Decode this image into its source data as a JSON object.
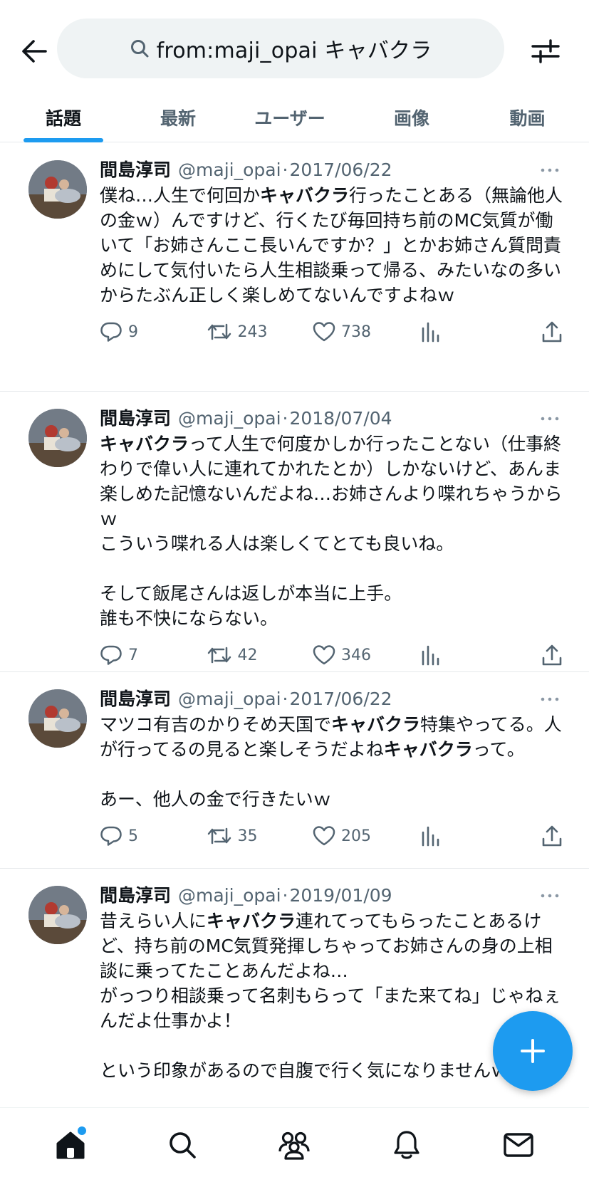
{
  "search": {
    "query": "from:maji_opai キャバクラ"
  },
  "tabs": [
    {
      "label": "話題",
      "active": true
    },
    {
      "label": "最新",
      "active": false
    },
    {
      "label": "ユーザー",
      "active": false
    },
    {
      "label": "画像",
      "active": false
    },
    {
      "label": "動画",
      "active": false
    }
  ],
  "posts": [
    {
      "name": "間島淳司",
      "handle": "@maji_opai",
      "date": "2017/06/22",
      "body_parts": [
        {
          "t": "僕ね…人生で何回か"
        },
        {
          "t": "キャバクラ",
          "b": true
        },
        {
          "t": "行ったことある（無論他人の金ｗ）んですけど、行くたび毎回持ち前のMC気質が働いて「お姉さんここ長いんですか？」とかお姉さん質問責めにして気付いたら人生相談乗って帰る、みたいなの多いからたぶん正しく楽しめてないんですよねｗ"
        }
      ],
      "replies": "9",
      "reposts": "243",
      "likes": "738"
    },
    {
      "name": "間島淳司",
      "handle": "@maji_opai",
      "date": "2018/07/04",
      "body_parts": [
        {
          "t": "キャバクラ",
          "b": true
        },
        {
          "t": "って人生で何度かしか行ったことない（仕事終わりで偉い人に連れてかれたとか）しかないけど、あんま楽しめた記憶ないんだよね…お姉さんより喋れちゃうからｗ\nこういう喋れる人は楽しくてとても良いね。\n\nそして飯尾さんは返しが本当に上手。\n誰も不快にならない。"
        }
      ],
      "replies": "7",
      "reposts": "42",
      "likes": "346"
    },
    {
      "name": "間島淳司",
      "handle": "@maji_opai",
      "date": "2017/06/22",
      "body_parts": [
        {
          "t": "マツコ有吉のかりそめ天国で"
        },
        {
          "t": "キャバクラ",
          "b": true
        },
        {
          "t": "特集やってる。人が行ってるの見ると楽しそうだよね"
        },
        {
          "t": "キャバクラ",
          "b": true
        },
        {
          "t": "って。\n\nあー、他人の金で行きたいｗ"
        }
      ],
      "replies": "5",
      "reposts": "35",
      "likes": "205"
    },
    {
      "name": "間島淳司",
      "handle": "@maji_opai",
      "date": "2019/01/09",
      "body_parts": [
        {
          "t": "昔えらい人に"
        },
        {
          "t": "キャバクラ",
          "b": true
        },
        {
          "t": "連れてってもらったことあるけど、持ち前のMC気質発揮しちゃってお姉さんの身の上相談に乗ってたことあんだよね…\nがっつり相談乗って名刺もらって「また来てね」じゃねぇんだよ仕事かよ！\n\nという印象があるので自腹で行く気になりませんｗ"
        }
      ],
      "replies": "",
      "reposts": "",
      "likes": ""
    }
  ],
  "icons": {
    "back": "arrow-left-icon",
    "search": "search-icon",
    "filter": "sliders-icon",
    "reply": "reply-icon",
    "repost": "repost-icon",
    "like": "heart-icon",
    "views": "analytics-icon",
    "share": "share-icon",
    "compose": "plus-icon",
    "home": "home-icon",
    "explore": "search-icon",
    "communities": "people-icon",
    "notifications": "bell-icon",
    "messages": "mail-icon"
  },
  "colors": {
    "accent": "#1d9bf0",
    "text": "#0f1419",
    "muted": "#536471"
  }
}
